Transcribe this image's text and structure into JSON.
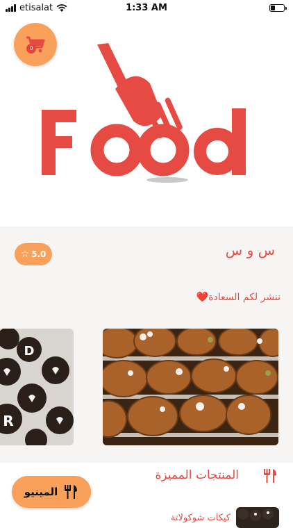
{
  "status_bar": {
    "carrier": "etisalat",
    "time": "1:33 AM"
  },
  "header": {
    "cart_count": "0",
    "logo_text": "Food",
    "brand_color": "#E54B42"
  },
  "store": {
    "name": "س و س",
    "rating": "5.0",
    "tagline": "ننشر لكم السعادة",
    "tagline_emoji": "❤️"
  },
  "gallery": {
    "items": [
      {
        "name": "coconut-cakes-photo"
      },
      {
        "name": "chocolate-letters-photo"
      }
    ]
  },
  "featured": {
    "title": "المنتجات المميزة",
    "first_product": "كيكات شوكولاتة"
  },
  "menu_button": {
    "label": "المينيو"
  },
  "colors": {
    "accent": "#F9A15A",
    "primary": "#E54B42",
    "section_bg": "#F6F5F4"
  }
}
